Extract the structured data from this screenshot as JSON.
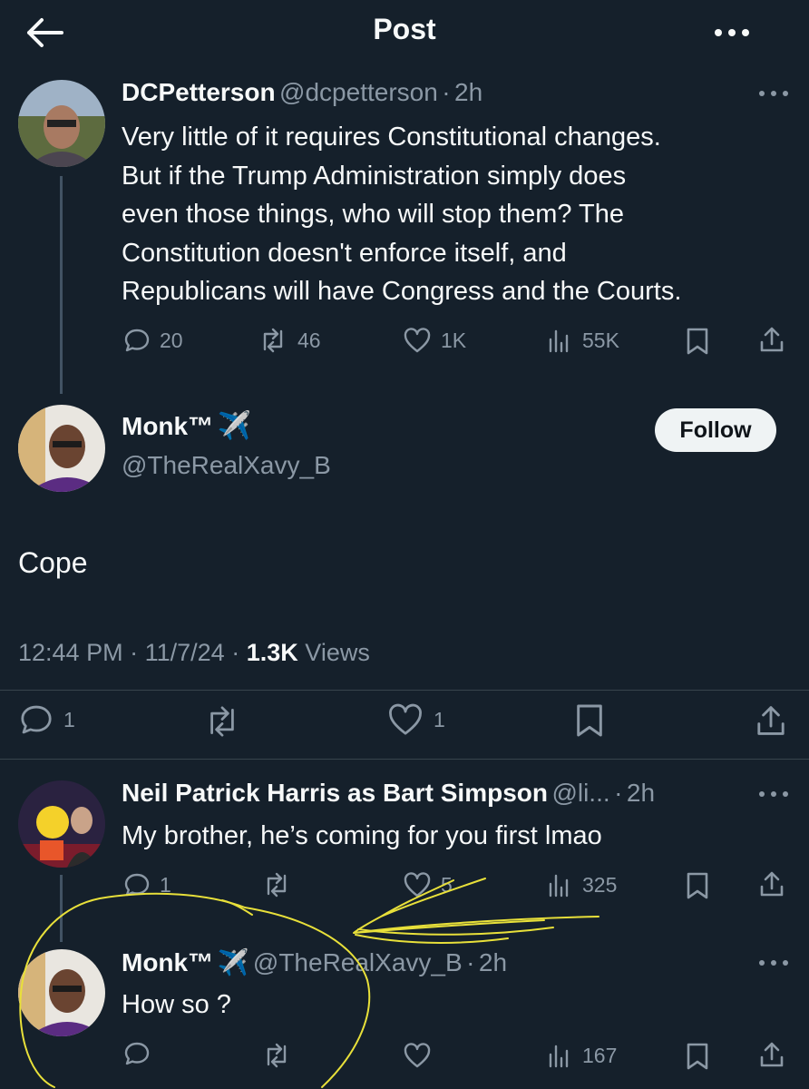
{
  "header": {
    "title": "Post"
  },
  "parent_tweet": {
    "name": "DCPetterson",
    "handle": "@dcpetterson",
    "time": "2h",
    "text_lines": [
      "Very little of it requires Constitutional changes.",
      "But if the Trump Administration simply does",
      "even those things, who will stop them? The",
      "Constitution doesn't enforce itself, and",
      "Republicans will have Congress and the Courts."
    ],
    "replies": "20",
    "reposts": "46",
    "likes": "1K",
    "views": "55K"
  },
  "main_tweet": {
    "name": "Monk™",
    "badge_emoji": "✈️",
    "handle": "@TheRealXavy_B",
    "follow_label": "Follow",
    "text": "Cope",
    "time": "12:44 PM",
    "date": "11/7/24",
    "views_count": "1.3K",
    "views_label": "Views",
    "replies": "1",
    "likes": "1"
  },
  "reply_tweet": {
    "name": "Neil Patrick Harris as Bart Simpson",
    "handle": "@li...",
    "time": "2h",
    "text": "My brother, he’s coming for you first lmao",
    "replies": "1",
    "likes": "5",
    "views": "325"
  },
  "reply2_tweet": {
    "name": "Monk™",
    "badge_emoji": "✈️",
    "handle": "@TheRealXavy_B",
    "time": "2h",
    "text": "How so ?",
    "views": "167"
  },
  "separator": "·",
  "annotation_color": "#e8e03a",
  "colors": {
    "background": "#15202b",
    "muted": "#8b98a5",
    "text": "#f7f9f9"
  }
}
